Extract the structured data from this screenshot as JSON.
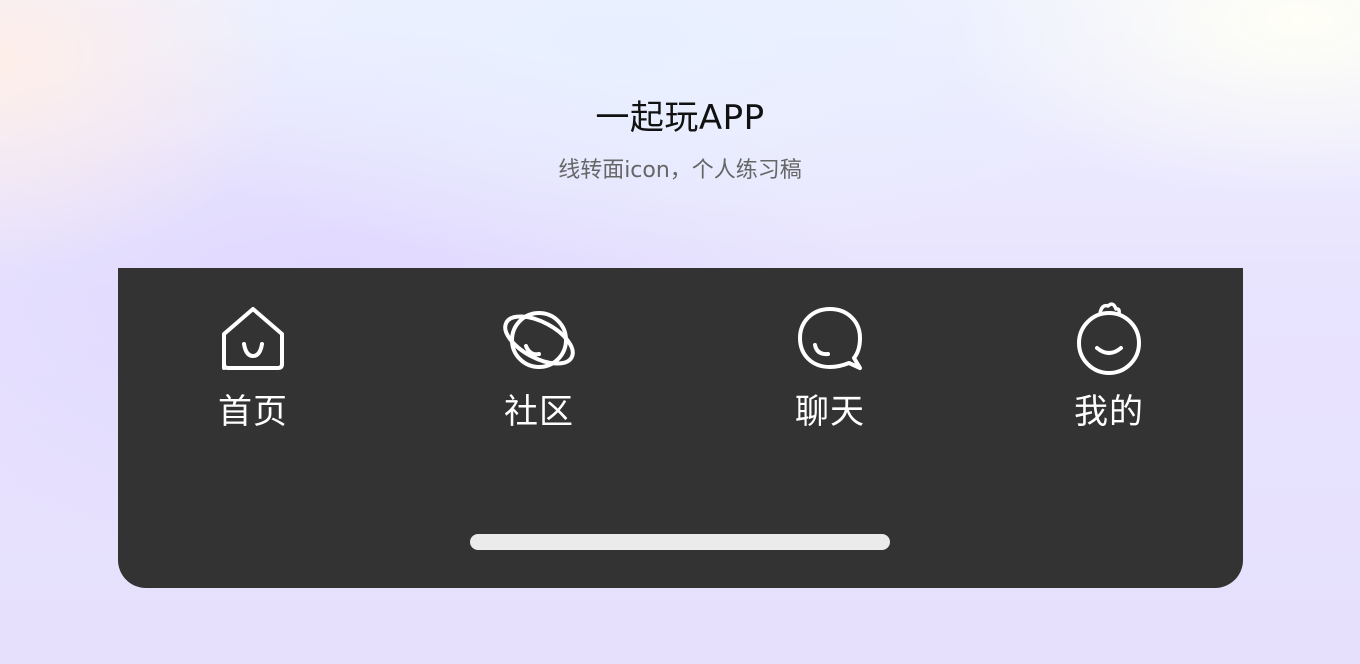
{
  "header": {
    "title": "一起玩APP",
    "subtitle": "线转面icon，个人练习稿"
  },
  "tab_bar": {
    "background": "#333333",
    "icon_color": "#ffffff",
    "items": [
      {
        "label": "首页",
        "icon": "home-icon"
      },
      {
        "label": "社区",
        "icon": "planet-icon"
      },
      {
        "label": "聊天",
        "icon": "chat-bubble-icon"
      },
      {
        "label": "我的",
        "icon": "smiley-face-icon"
      }
    ]
  }
}
